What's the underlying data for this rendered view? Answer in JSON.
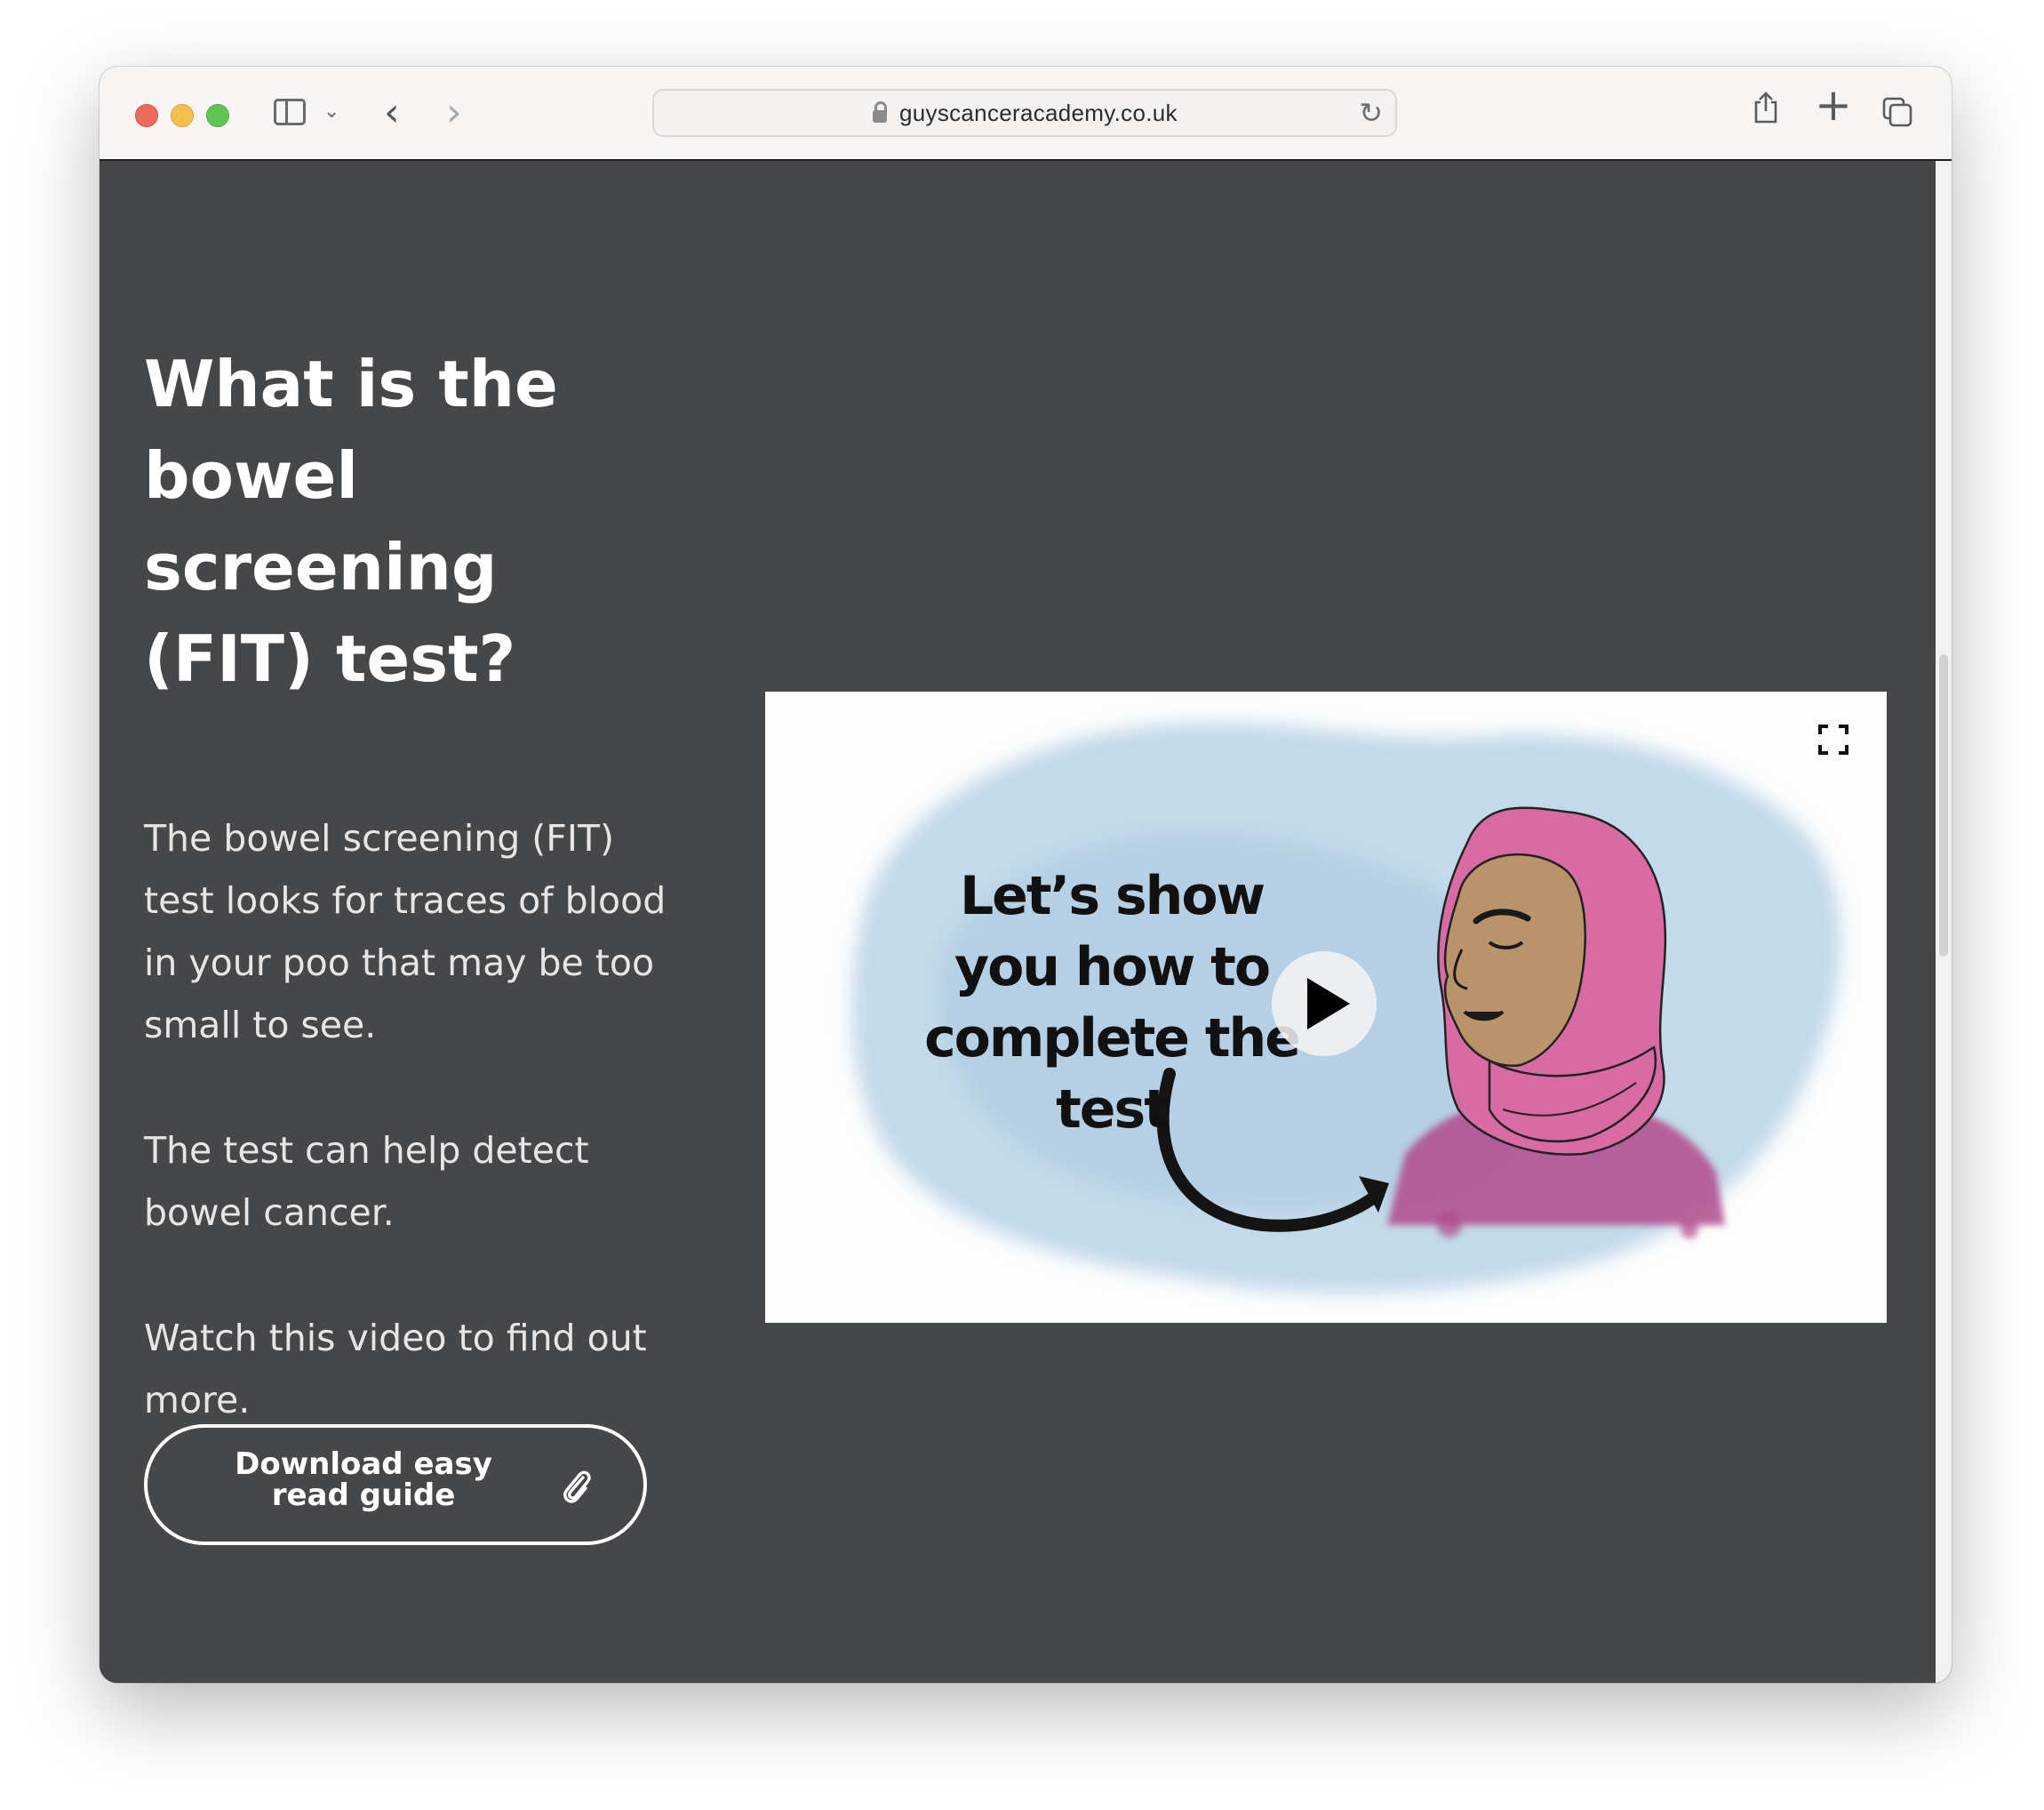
{
  "browser": {
    "url": "guyscanceracademy.co.uk",
    "icons": [
      "sidebar-icon",
      "chevron-down-icon",
      "back-icon",
      "forward-icon",
      "lock-icon",
      "reload-icon",
      "share-icon",
      "plus-icon",
      "tabs-overview-icon"
    ]
  },
  "main": {
    "heading": "What is the bowel screening (FIT) test?",
    "paragraphs": [
      "The bowel screening (FIT) test looks for traces of blood in your poo that may be too small to see.",
      "The test can help detect bowel cancer.",
      "Watch this video to find out more."
    ],
    "download_button": {
      "label": "Download easy read guide",
      "icon": "paperclip-icon"
    }
  },
  "video": {
    "caption": "Let’s show you how to complete the test",
    "icons": [
      "play-icon",
      "fullscreen-icon"
    ],
    "colors": {
      "watercolor_blue": "#b9d4e6",
      "hijab_pink": "#d9649e",
      "skin": "#b8926a"
    }
  },
  "colors": {
    "page_background": "#464749",
    "text": "#ffffff",
    "toolbar": "#f6f5f4"
  }
}
